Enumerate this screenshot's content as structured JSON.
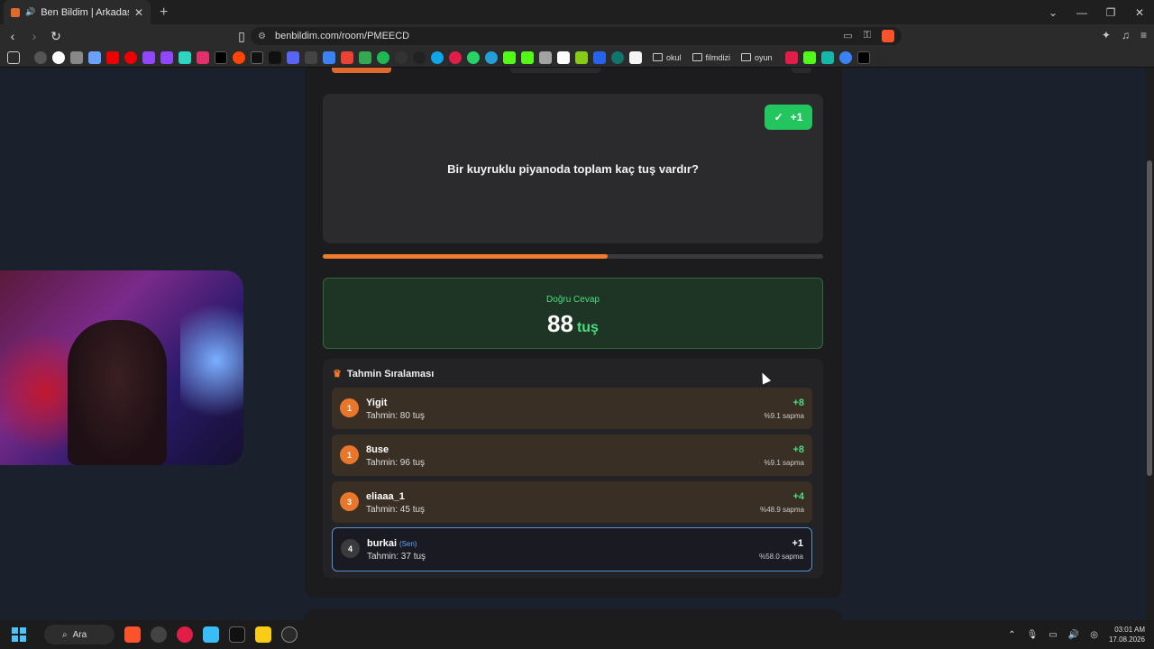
{
  "browser": {
    "tab_title": "Ben Bildim | Arkadaşlarınla O",
    "url": "benbildim.com/room/PMEECD",
    "bookmarks": {
      "folders": [
        "okul",
        "filmdizi",
        "oyun"
      ]
    }
  },
  "quiz": {
    "badge": "+1",
    "question": "Bir kuyruklu piyanoda toplam kaç tuş vardır?",
    "progress_fraction": 0.57
  },
  "answer": {
    "label": "Doğru Cevap",
    "value": "88",
    "unit": "tuş"
  },
  "ranking": {
    "title": "Tahmin Sıralaması",
    "rows": [
      {
        "rank": "1",
        "name": "Yigit",
        "guess": "Tahmin: 80 tuş",
        "points": "+8",
        "deviation": "%9.1 sapma"
      },
      {
        "rank": "1",
        "name": "8use",
        "guess": "Tahmin: 96 tuş",
        "points": "+8",
        "deviation": "%9.1 sapma"
      },
      {
        "rank": "3",
        "name": "eliaaa_1",
        "guess": "Tahmin: 45 tuş",
        "points": "+4",
        "deviation": "%48.9 sapma"
      },
      {
        "rank": "4",
        "name": "burkai",
        "you": "(Sen)",
        "guess": "Tahmin: 37 tuş",
        "points": "+1",
        "deviation": "%58.0 sapma"
      }
    ]
  },
  "taskbar": {
    "search_label": "Ara",
    "time": "03:01 AM",
    "date": "17.08.2026"
  }
}
